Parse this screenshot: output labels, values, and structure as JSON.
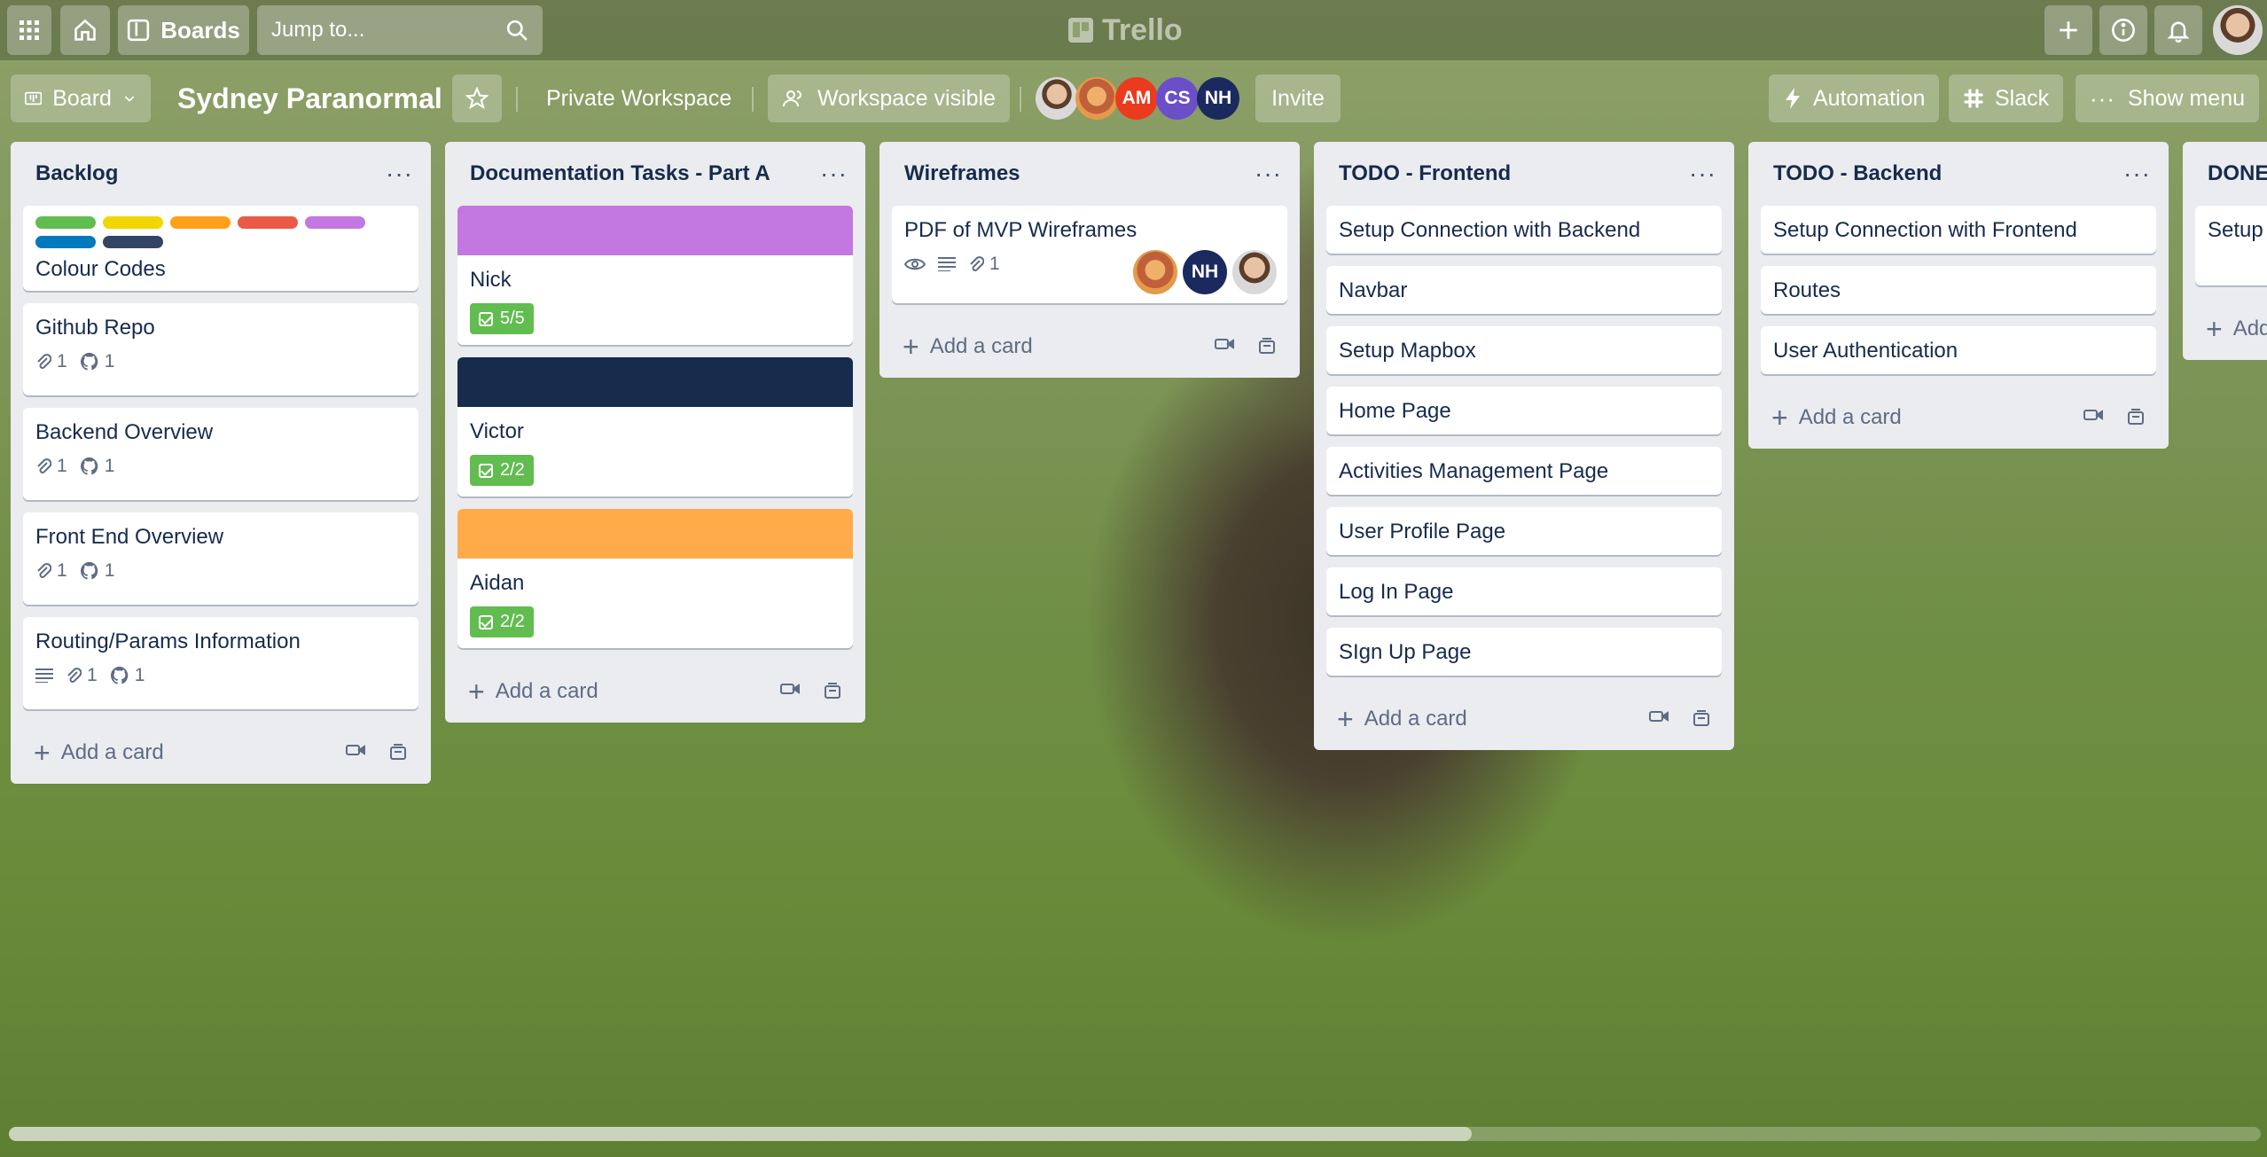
{
  "topbar": {
    "boards_label": "Boards",
    "search_placeholder": "Jump to...",
    "logo_text": "Trello"
  },
  "board": {
    "view_label": "Board",
    "title": "Sydney Paranormal",
    "workspace": "Private Workspace",
    "visibility": "Workspace visible",
    "members": [
      "AM",
      "CS",
      "NH"
    ],
    "invite_label": "Invite",
    "automation_label": "Automation",
    "slack_label": "Slack",
    "menu_label": "Show menu"
  },
  "add_card_label": "Add a card",
  "lists": [
    {
      "title": "Backlog",
      "cards": [
        {
          "title": "Colour Codes",
          "labels": [
            "#61bd4f",
            "#f2d600",
            "#ff9f1a",
            "#eb5a46",
            "#c377e0",
            "#0079bf",
            "#344563"
          ]
        },
        {
          "title": "Github Repo",
          "attachments": "1",
          "github": "1"
        },
        {
          "title": "Backend Overview",
          "attachments": "1",
          "github": "1"
        },
        {
          "title": "Front End Overview",
          "attachments": "1",
          "github": "1"
        },
        {
          "title": "Routing/Params Information",
          "attachments": "1",
          "github": "1"
        }
      ]
    },
    {
      "title": "Documentation Tasks - Part A",
      "cards": [
        {
          "title": "Nick",
          "cover": "#c377e0",
          "checklist": "5/5"
        },
        {
          "title": "Victor",
          "cover": "#172b4d",
          "checklist": "2/2"
        },
        {
          "title": "Aidan",
          "cover": "#ffab4a",
          "checklist": "2/2"
        }
      ]
    },
    {
      "title": "Wireframes",
      "cards": [
        {
          "title": "PDF of MVP Wireframes",
          "attachments": "1",
          "members": [
            "NH"
          ]
        }
      ]
    },
    {
      "title": "TODO - Frontend",
      "cards": [
        {
          "title": "Setup Connection with Backend"
        },
        {
          "title": "Navbar"
        },
        {
          "title": "Setup Mapbox"
        },
        {
          "title": "Home Page"
        },
        {
          "title": "Activities Management Page"
        },
        {
          "title": "User Profile Page"
        },
        {
          "title": "Log In Page"
        },
        {
          "title": "SIgn Up Page"
        }
      ]
    },
    {
      "title": "TODO - Backend",
      "cards": [
        {
          "title": "Setup Connection with Frontend"
        },
        {
          "title": "Routes"
        },
        {
          "title": "User Authentication"
        }
      ]
    },
    {
      "title": "DONE",
      "cards": [
        {
          "title": "Setup"
        }
      ]
    }
  ]
}
